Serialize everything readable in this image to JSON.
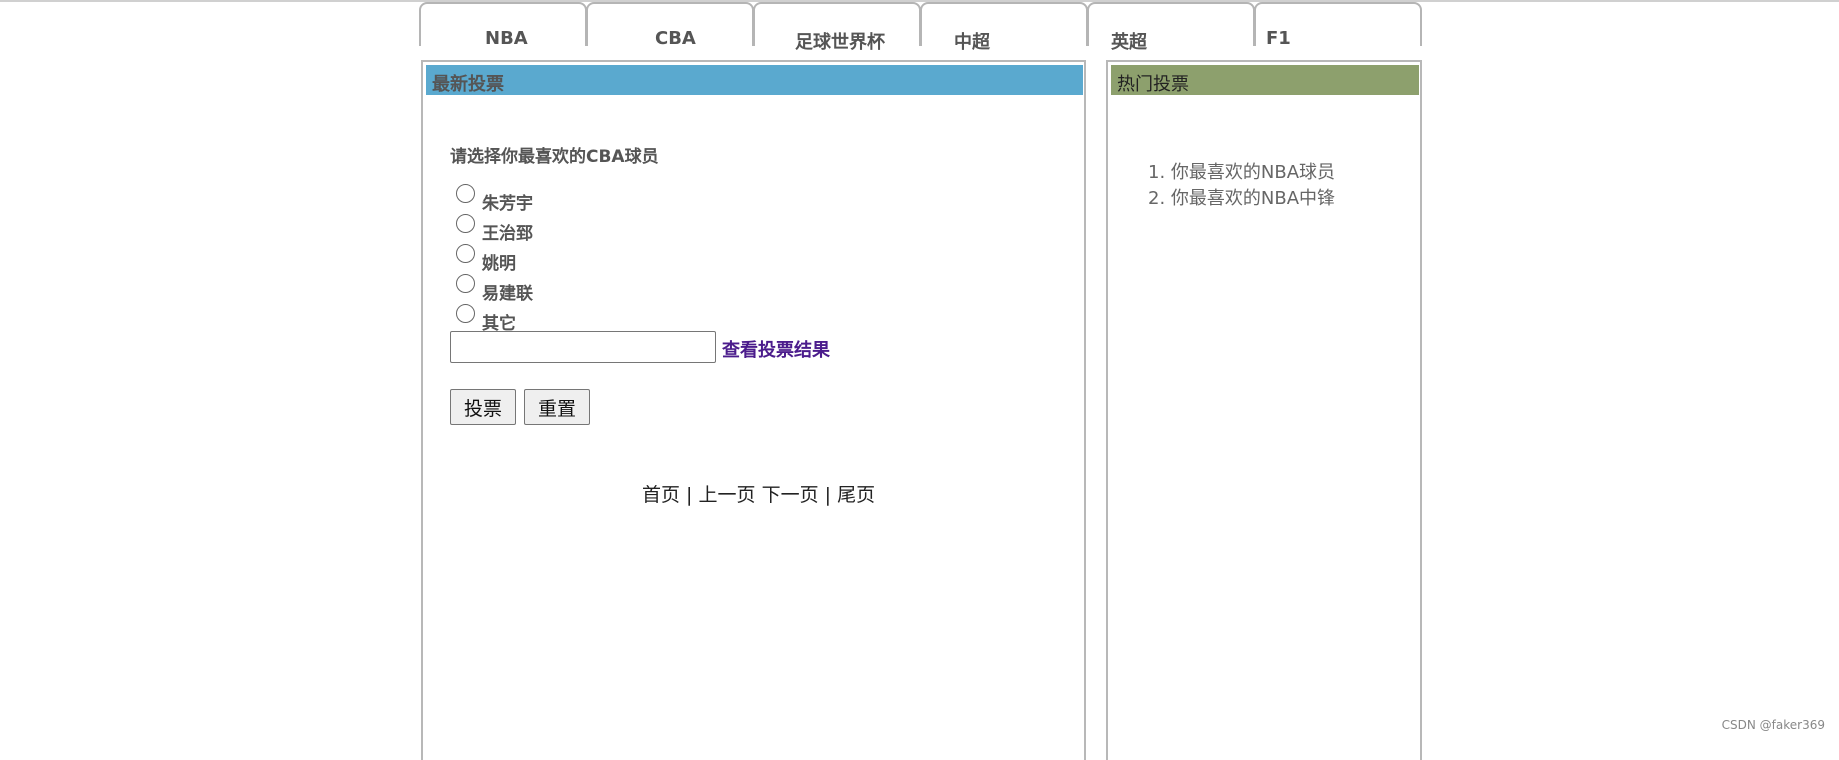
{
  "nav": {
    "tabs": [
      {
        "label": "NBA"
      },
      {
        "label": "CBA"
      },
      {
        "label": "足球世界杯"
      },
      {
        "label": "中超"
      },
      {
        "label": "英超"
      },
      {
        "label": "F1"
      }
    ]
  },
  "latest_vote": {
    "title": "最新投票",
    "question": "请选择你最喜欢的CBA球员",
    "options": [
      "朱芳宇",
      "王治郅",
      "姚明",
      "易建联",
      "其它"
    ],
    "input_value": "",
    "result_link": "查看投票结果",
    "vote_button": "投票",
    "reset_button": "重置",
    "pager": {
      "first": "首页",
      "sep1": " | ",
      "prev": "上一页",
      "space": " ",
      "next": "下一页",
      "sep2": " | ",
      "last": "尾页"
    },
    "header_color": "#5aa9cf"
  },
  "hot_vote": {
    "title": "热门投票",
    "items": [
      "1. 你最喜欢的NBA球员",
      "2. 你最喜欢的NBA中锋"
    ],
    "header_color": "#8da06d"
  },
  "watermark": "CSDN @faker369"
}
